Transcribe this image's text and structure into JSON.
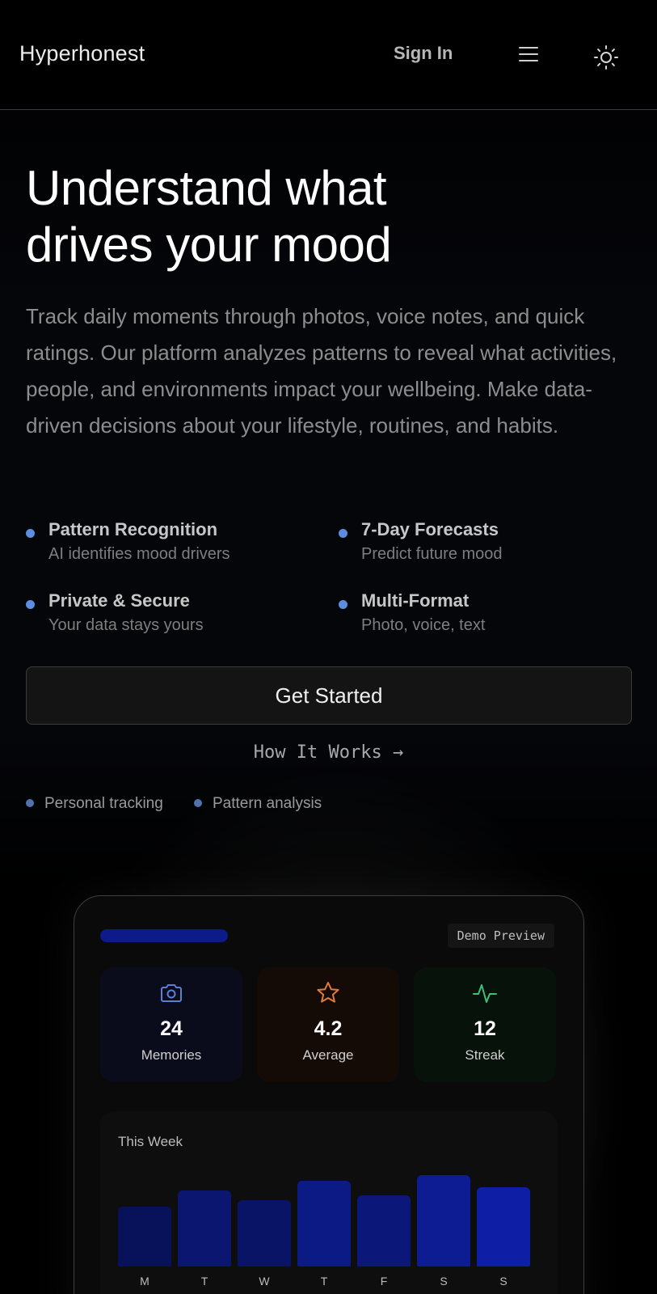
{
  "header": {
    "brand": "Hyperhonest",
    "sign_in": "Sign In",
    "menu_icon": "hamburger-menu-icon",
    "theme_icon": "sun-icon"
  },
  "hero": {
    "title_line1": "Understand what",
    "title_line2": "drives your mood",
    "description": "Track daily moments through photos, voice notes, and quick ratings. Our platform analyzes patterns to reveal what activities, people, and environments impact your wellbeing. Make data-driven decisions about your lifestyle, routines, and habits."
  },
  "features": [
    {
      "title": "Pattern Recognition",
      "desc": "AI identifies mood drivers"
    },
    {
      "title": "7-Day Forecasts",
      "desc": "Predict future mood"
    },
    {
      "title": "Private & Secure",
      "desc": "Your data stays yours"
    },
    {
      "title": "Multi-Format",
      "desc": "Photo, voice, text"
    }
  ],
  "cta": {
    "primary": "Get Started",
    "secondary": "How It Works →"
  },
  "tags": [
    "Personal tracking",
    "Pattern analysis"
  ],
  "demo": {
    "badge": "Demo Preview",
    "stats": [
      {
        "icon": "camera-icon",
        "value": "24",
        "label": "Memories",
        "color": "#5b7fd6"
      },
      {
        "icon": "star-icon",
        "value": "4.2",
        "label": "Average",
        "color": "#e07b3c"
      },
      {
        "icon": "activity-pulse-icon",
        "value": "12",
        "label": "Streak",
        "color": "#3fbf7a"
      }
    ],
    "week": {
      "title": "This Week",
      "days": [
        "M",
        "T",
        "W",
        "T",
        "F",
        "S",
        "S"
      ],
      "levels": [
        0.62,
        0.78,
        0.68,
        0.88,
        0.73,
        0.94,
        0.82
      ]
    }
  },
  "colors": {
    "accent_dot": "#5b8de0",
    "bar_color": "#0c1fa0"
  }
}
